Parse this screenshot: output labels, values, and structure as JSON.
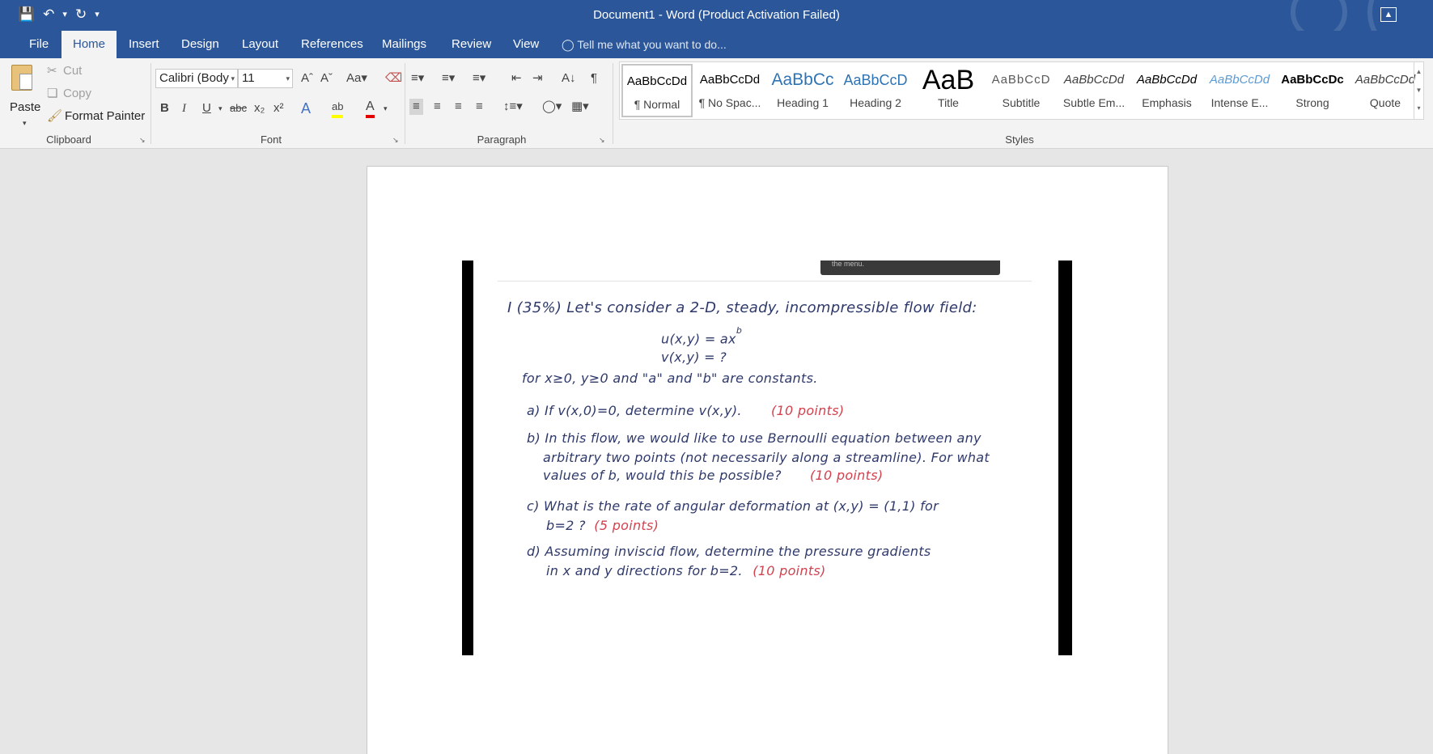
{
  "window": {
    "title": "Document1 - Word (Product Activation Failed)"
  },
  "tabs": {
    "file": "File",
    "home": "Home",
    "insert": "Insert",
    "design": "Design",
    "layout": "Layout",
    "references": "References",
    "mailings": "Mailings",
    "review": "Review",
    "view": "View",
    "tell_me": "Tell me what you want to do..."
  },
  "clipboard": {
    "paste": "Paste",
    "cut": "Cut",
    "copy": "Copy",
    "format_painter": "Format Painter",
    "group_label": "Clipboard"
  },
  "font": {
    "family": "Calibri (Body",
    "size": "11",
    "group_label": "Font"
  },
  "paragraph": {
    "group_label": "Paragraph"
  },
  "styles": {
    "group_label": "Styles",
    "items": [
      {
        "preview": "AaBbCcDd",
        "name": "¶ Normal"
      },
      {
        "preview": "AaBbCcDd",
        "name": "¶ No Spac..."
      },
      {
        "preview": "AaBbCc",
        "name": "Heading 1"
      },
      {
        "preview": "AaBbCcD",
        "name": "Heading 2"
      },
      {
        "preview": "AaB",
        "name": "Title"
      },
      {
        "preview": "AaBbCcD",
        "name": "Subtitle"
      },
      {
        "preview": "AaBbCcDd",
        "name": "Subtle Em..."
      },
      {
        "preview": "AaBbCcDd",
        "name": "Emphasis"
      },
      {
        "preview": "AaBbCcDd",
        "name": "Intense E..."
      },
      {
        "preview": "AaBbCcDc",
        "name": "Strong"
      },
      {
        "preview": "AaBbCcDd",
        "name": "Quote"
      }
    ]
  },
  "document": {
    "tooltip_fragment": "the menu.",
    "problem": {
      "line1": "I (35%) Let's consider a 2-D, steady, incompressible flow field:",
      "eq_u": "u(x,y) = ax",
      "eq_u_exp": "b",
      "eq_v": "v(x,y) = ?",
      "constants": "for x≥0, y≥0 and \"a\" and \"b\" are constants.",
      "a_text": "a) If v(x,0)=0, determine v(x,y).",
      "a_points": "(10 points)",
      "b_line1": "b) In this flow, we would like to use Bernoulli equation between any",
      "b_line2": "arbitrary two points (not necessarily along a streamline). For what",
      "b_line3": "values of b, would this be possible?",
      "b_points": "(10 points)",
      "c_line1": "c) What is the rate of angular deformation at (x,y) = (1,1) for",
      "c_line2": "b=2 ?",
      "c_points": "(5 points)",
      "d_line1": "d) Assuming inviscid flow, determine the pressure gradients",
      "d_line2": "in x and y directions for b=2.",
      "d_points": "(10 points)"
    }
  }
}
